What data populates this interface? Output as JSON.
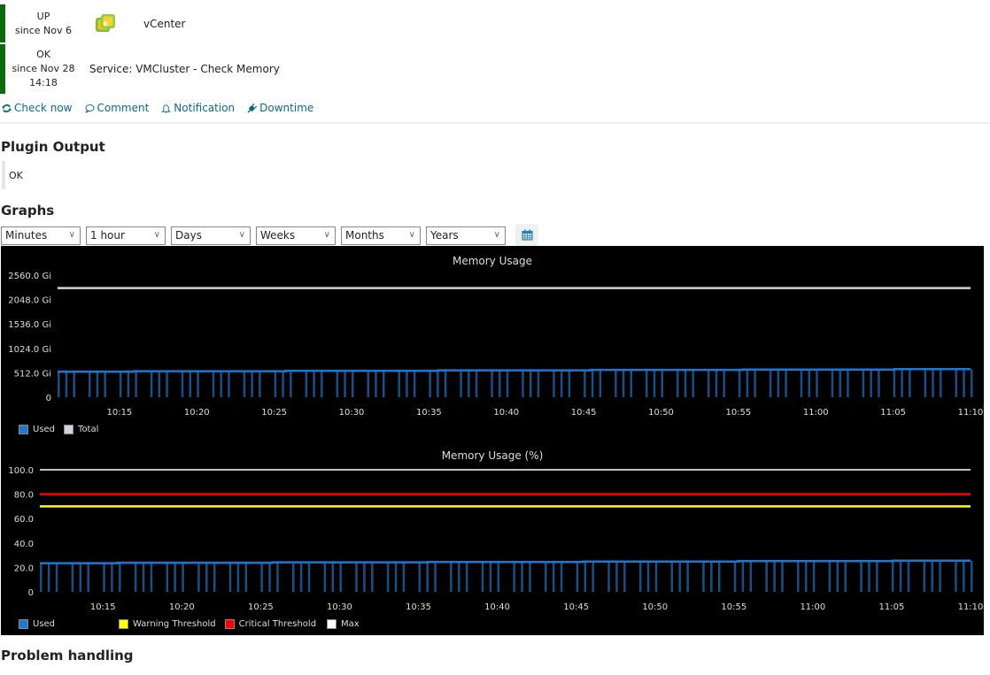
{
  "host": {
    "state": "UP",
    "since": "since Nov 6",
    "name": "vCenter",
    "icon": "vsphere-icon"
  },
  "service": {
    "state": "OK",
    "since": "since Nov 28",
    "since_time": "14:18",
    "name": "Service: VMCluster - Check Memory"
  },
  "colors": {
    "ok": "#0d6a0d",
    "link": "#0a6a8a"
  },
  "actions": [
    {
      "label": "Check now",
      "icon": "refresh-icon"
    },
    {
      "label": "Comment",
      "icon": "comment-icon"
    },
    {
      "label": "Notification",
      "icon": "bell-icon"
    },
    {
      "label": "Downtime",
      "icon": "plug-icon"
    }
  ],
  "plugin_output": {
    "heading": "Plugin Output",
    "text": "OK"
  },
  "graphs": {
    "heading": "Graphs",
    "selects": [
      "Minutes",
      "1 hour",
      "Days",
      "Weeks",
      "Months",
      "Years"
    ],
    "calendar_icon": "calendar-icon"
  },
  "problem_handling": {
    "heading": "Problem handling"
  },
  "chart_data": [
    {
      "type": "area",
      "title": "Memory Usage",
      "ylim": [
        0,
        2560
      ],
      "y_ticks": [
        0,
        512,
        1024,
        1536,
        2048,
        2560
      ],
      "y_tick_labels": [
        "0",
        "512.0 Gi",
        "1024.0 Gi",
        "1536.0 Gi",
        "2048.0 Gi",
        "2560.0 Gi"
      ],
      "x_tick_labels": [
        "10:15",
        "10:20",
        "10:25",
        "10:30",
        "10:35",
        "10:40",
        "10:45",
        "10:50",
        "10:55",
        "11:00",
        "11:05",
        "11:10"
      ],
      "x_range": [
        "10:11",
        "11:10"
      ],
      "series": [
        {
          "name": "Used",
          "color": "#1e78d2",
          "start": 535,
          "end": 590,
          "unit": "Gi"
        },
        {
          "name": "Total",
          "color": "#d0d4e0",
          "value": 2288,
          "unit": "Gi"
        }
      ],
      "legend": [
        {
          "label": "Used",
          "color": "#1e78d2"
        },
        {
          "label": "Total",
          "color": "#d0d4e0"
        }
      ]
    },
    {
      "type": "area",
      "title": "Memory Usage (%)",
      "ylim": [
        0,
        100
      ],
      "y_ticks": [
        0,
        20,
        40,
        60,
        80,
        100
      ],
      "y_tick_labels": [
        "0",
        "20.0",
        "40.0",
        "60.0",
        "80.0",
        "100.0"
      ],
      "x_tick_labels": [
        "10:15",
        "10:20",
        "10:25",
        "10:30",
        "10:35",
        "10:40",
        "10:45",
        "10:50",
        "10:55",
        "11:00",
        "11:05",
        "11:10"
      ],
      "x_range": [
        "10:11",
        "11:10"
      ],
      "series": [
        {
          "name": "Used",
          "color": "#1e78d2",
          "start": 23.5,
          "end": 25.5
        },
        {
          "name": "Warning Threshold",
          "color": "#ffff00",
          "value": 70
        },
        {
          "name": "Critical Threshold",
          "color": "#ff0000",
          "value": 80
        },
        {
          "name": "Max",
          "color": "#ffffff",
          "value": 100
        }
      ],
      "legend": [
        {
          "label": "Used",
          "color": "#1e78d2"
        },
        {
          "label": "Warning Threshold",
          "color": "#ffff00"
        },
        {
          "label": "Critical Threshold",
          "color": "#ff0000"
        },
        {
          "label": "Max",
          "color": "#ffffff"
        }
      ]
    }
  ]
}
